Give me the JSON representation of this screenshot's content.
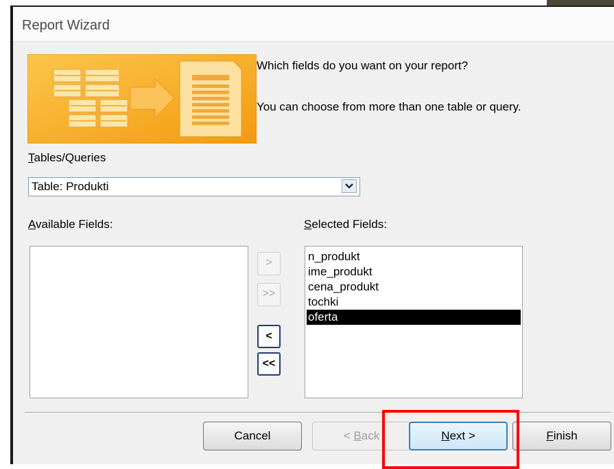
{
  "window": {
    "title": "Report Wizard"
  },
  "prompts": {
    "question": "Which fields do you want on your report?",
    "hint": "You can choose from more than one table or query."
  },
  "tables_queries": {
    "label_access_key": "T",
    "label_rest": "ables/Queries",
    "value": "Table: Produkti"
  },
  "available_fields": {
    "label_access_key": "A",
    "label_rest": "vailable Fields:",
    "items": []
  },
  "selected_fields": {
    "label_access_key": "S",
    "label_rest": "elected Fields:",
    "items": [
      "n_produkt",
      "ime_produkt",
      "cena_produkt",
      "tochki",
      "oferta"
    ],
    "selected_item": "oferta"
  },
  "move_buttons": {
    "add_one": ">",
    "add_all": ">>",
    "remove_one": "<",
    "remove_all": "<<"
  },
  "buttons": {
    "cancel": "Cancel",
    "back_prefix": "< ",
    "back_key": "B",
    "back_rest": "ack",
    "next_key": "N",
    "next_rest": "ext >",
    "finish_key": "F",
    "finish_rest": "inish"
  },
  "colors": {
    "graphic_orange": "#f7a823",
    "selection": "#000000",
    "annotation": "#ff0000"
  },
  "icons": [
    "table-to-report-wizard-graphic",
    "dropdown-arrow-icon"
  ]
}
